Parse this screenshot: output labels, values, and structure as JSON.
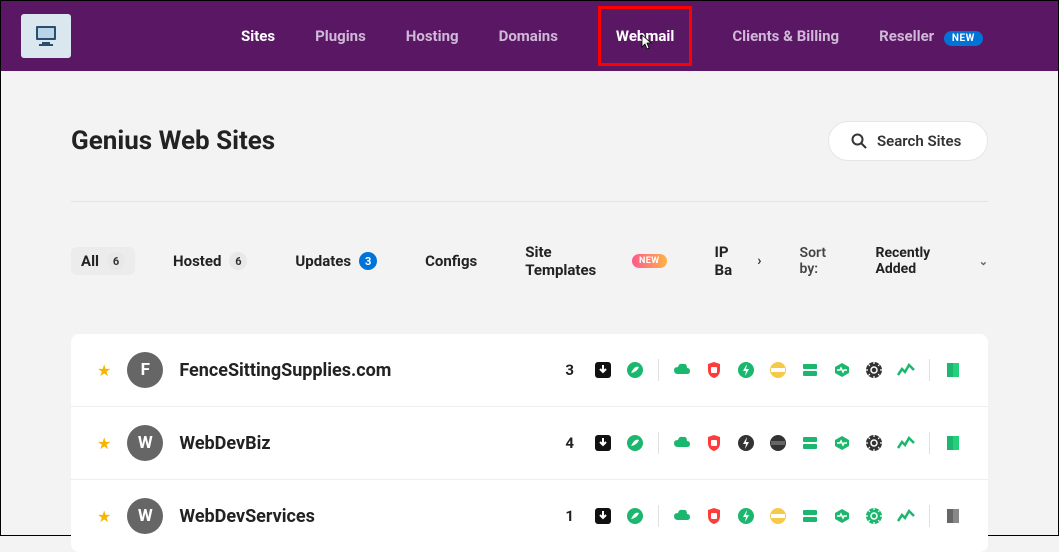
{
  "nav": {
    "items": [
      {
        "label": "Sites",
        "active": true
      },
      {
        "label": "Plugins"
      },
      {
        "label": "Hosting"
      },
      {
        "label": "Domains"
      },
      {
        "label": "Webmail",
        "highlighted": true
      },
      {
        "label": "Clients & Billing"
      },
      {
        "label": "Reseller",
        "badge": "NEW"
      }
    ]
  },
  "page": {
    "title": "Genius Web Sites",
    "search_placeholder": "Search Sites"
  },
  "filters": {
    "all": {
      "label": "All",
      "count": "6"
    },
    "hosted": {
      "label": "Hosted",
      "count": "6"
    },
    "updates": {
      "label": "Updates",
      "count": "3"
    },
    "configs": {
      "label": "Configs"
    },
    "templates": {
      "label": "Site Templates",
      "badge": "NEW"
    },
    "ipba": {
      "label": "IP Ba"
    }
  },
  "sort": {
    "label": "Sort by:",
    "value": "Recently Added"
  },
  "sites": [
    {
      "initial": "F",
      "name": "FenceSittingSupplies.com",
      "updates": "3"
    },
    {
      "initial": "W",
      "name": "WebDevBiz",
      "updates": "4"
    },
    {
      "initial": "W",
      "name": "WebDevServices",
      "updates": "1"
    }
  ]
}
